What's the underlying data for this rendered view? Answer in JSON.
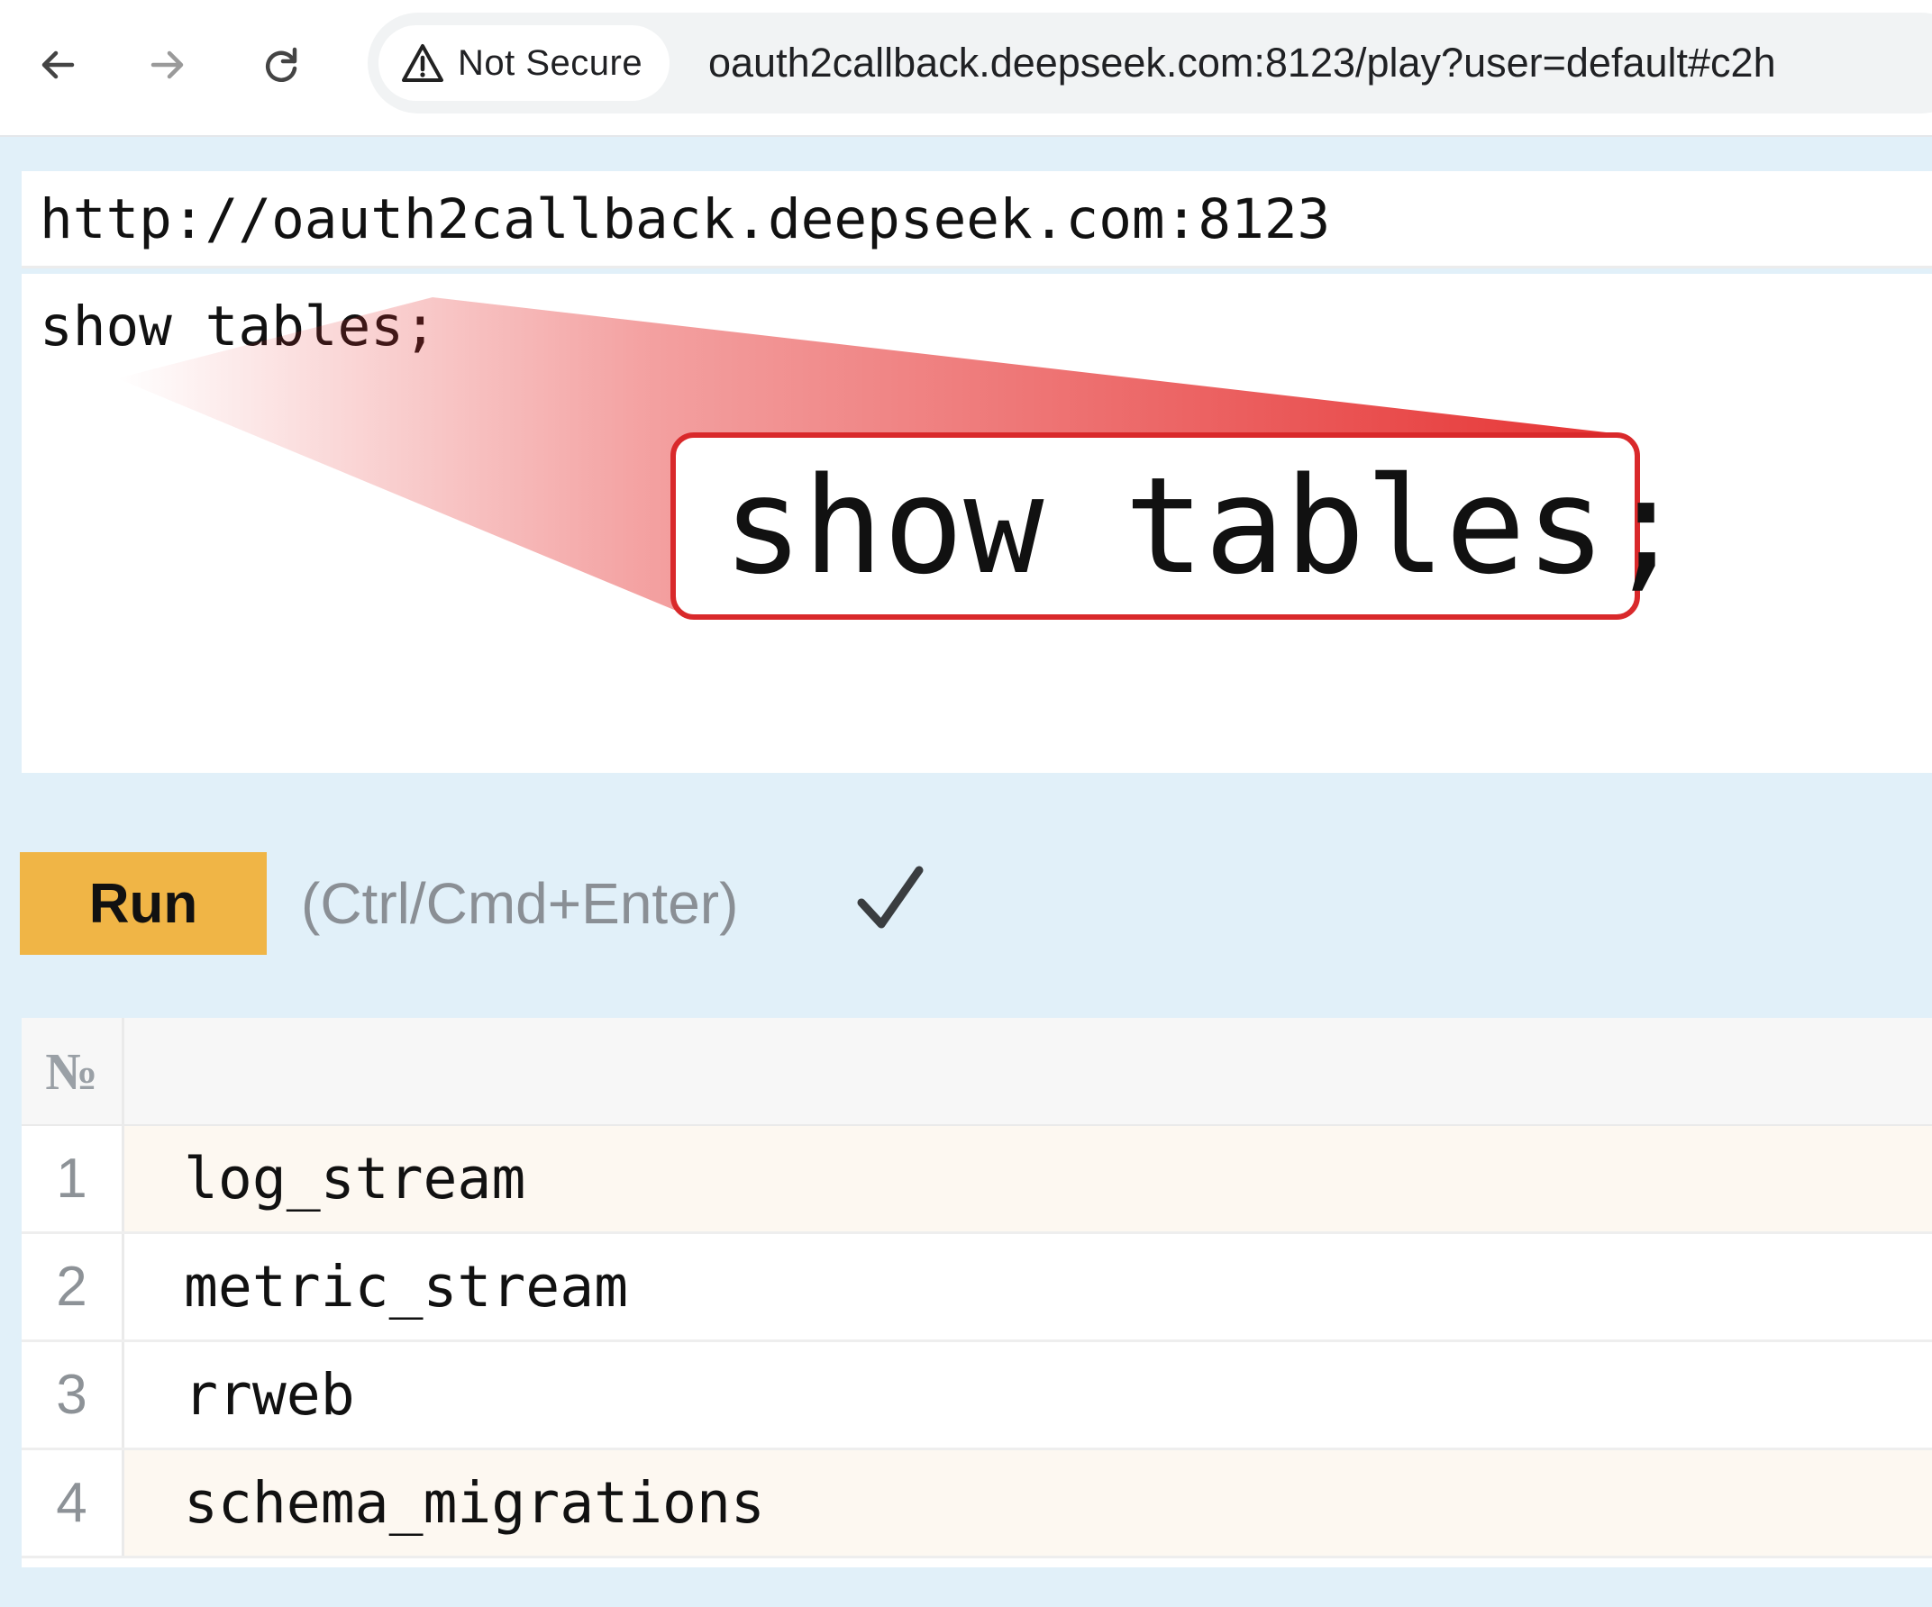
{
  "browser": {
    "security_label": "Not Secure",
    "address": "oauth2callback.deepseek.com:8123/play?user=default#c2h"
  },
  "query": {
    "server_url": "http://oauth2callback.deepseek.com:8123",
    "text": "show tables;",
    "zoom_text": "show tables;"
  },
  "run": {
    "label": "Run",
    "shortcut": "(Ctrl/Cmd+Enter)"
  },
  "results": {
    "number_header": "№",
    "rows": [
      {
        "num": "1",
        "value": "log_stream"
      },
      {
        "num": "2",
        "value": "metric_stream"
      },
      {
        "num": "3",
        "value": "rrweb"
      },
      {
        "num": "4",
        "value": "schema_migrations"
      }
    ]
  },
  "colors": {
    "run_button": "#f0b546",
    "callout_border": "#d9292b",
    "page_background": "#e1f0f9",
    "stripe": "#fdf8f1"
  }
}
